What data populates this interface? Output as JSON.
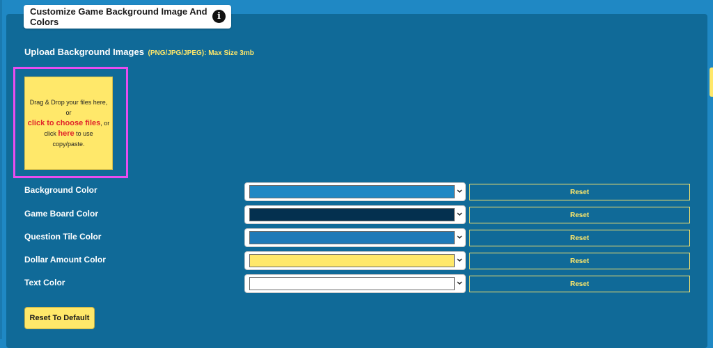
{
  "header": {
    "title": "Customize Game Background Image And Colors",
    "info_icon": "info-icon"
  },
  "upload": {
    "label": "Upload Background Images",
    "hint": "(PNG/JPG/JPEG): Max Size 3mb",
    "dropzone": {
      "line1": "Drag & Drop your files here,",
      "line2": "or",
      "choose_link": "click to choose files",
      "after_choose": ", or",
      "click_prefix": "click",
      "here_link": "here",
      "after_here": "to use",
      "line_last": "copy/paste."
    }
  },
  "colors": [
    {
      "label": "Background Color",
      "value": "#1f88c4",
      "reset_label": "Reset"
    },
    {
      "label": "Game Board Color",
      "value": "#04304f",
      "reset_label": "Reset"
    },
    {
      "label": "Question Tile Color",
      "value": "#1f7ab8",
      "reset_label": "Reset"
    },
    {
      "label": "Dollar Amount Color",
      "value": "#ffe86a",
      "reset_label": "Reset"
    },
    {
      "label": "Text Color",
      "value": "#ffffff",
      "reset_label": "Reset"
    }
  ],
  "reset_default_label": "Reset To Default",
  "theme": {
    "accent": "#ffe86a",
    "panel": "#106a98",
    "page": "#1f88c4",
    "highlight": "#e94cf0"
  }
}
